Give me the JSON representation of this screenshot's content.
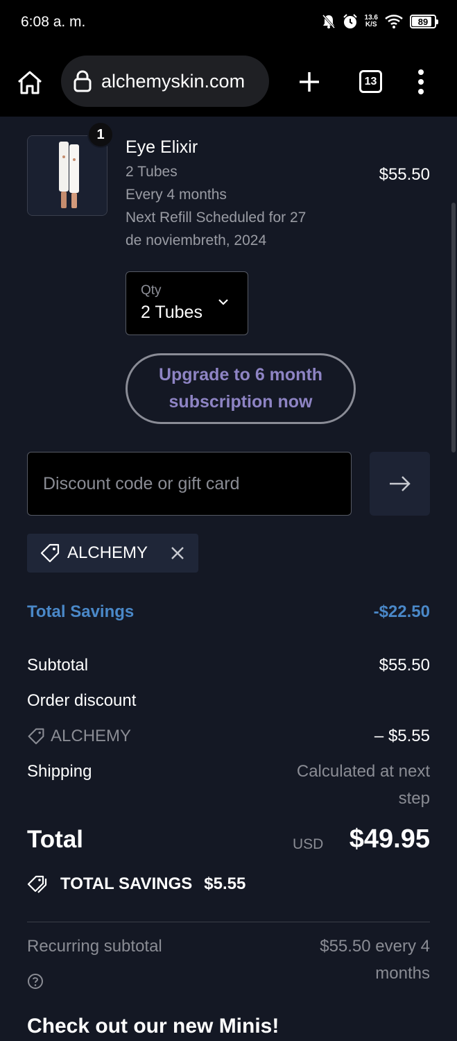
{
  "status_bar": {
    "time": "6:08 a. m.",
    "net_speed_value": "13.6",
    "net_speed_unit": "K/S",
    "battery": "89",
    "battery_level": 0.89
  },
  "browser": {
    "url": "alchemyskin.com",
    "tab_count": "13"
  },
  "cart_item": {
    "badge_count": "1",
    "name": "Eye Elixir",
    "variant": "2 Tubes",
    "frequency": "Every 4 months",
    "refill_line1": "Next Refill Scheduled for 27",
    "refill_line2": "de noviembreth, 2024",
    "price": "$55.50",
    "qty_label": "Qty",
    "qty_value": "2 Tubes",
    "upgrade_label": "Upgrade to 6 month subscription now"
  },
  "discount": {
    "placeholder": "Discount code or gift card",
    "applied_code": "ALCHEMY"
  },
  "summary": {
    "total_savings_label": "Total Savings",
    "total_savings_value": "-$22.50",
    "subtotal_label": "Subtotal",
    "subtotal_value": "$55.50",
    "order_discount_label": "Order discount",
    "discount_code": "ALCHEMY",
    "discount_value": "– $5.55",
    "shipping_label": "Shipping",
    "shipping_value_line1": "Calculated at next",
    "shipping_value_line2": "step",
    "total_label": "Total",
    "currency": "USD",
    "total_value": "$49.95",
    "savings_banner_label": "TOTAL SAVINGS",
    "savings_banner_value": "$5.55",
    "recurring_label": "Recurring subtotal",
    "recurring_value_line1": "$55.50 every 4",
    "recurring_value_line2": "months"
  },
  "promo": {
    "minis_title": "Check out our new Minis!"
  },
  "colors": {
    "background": "#141824",
    "savings_blue": "#4a88c8",
    "upgrade_purple": "#8e84c4"
  }
}
